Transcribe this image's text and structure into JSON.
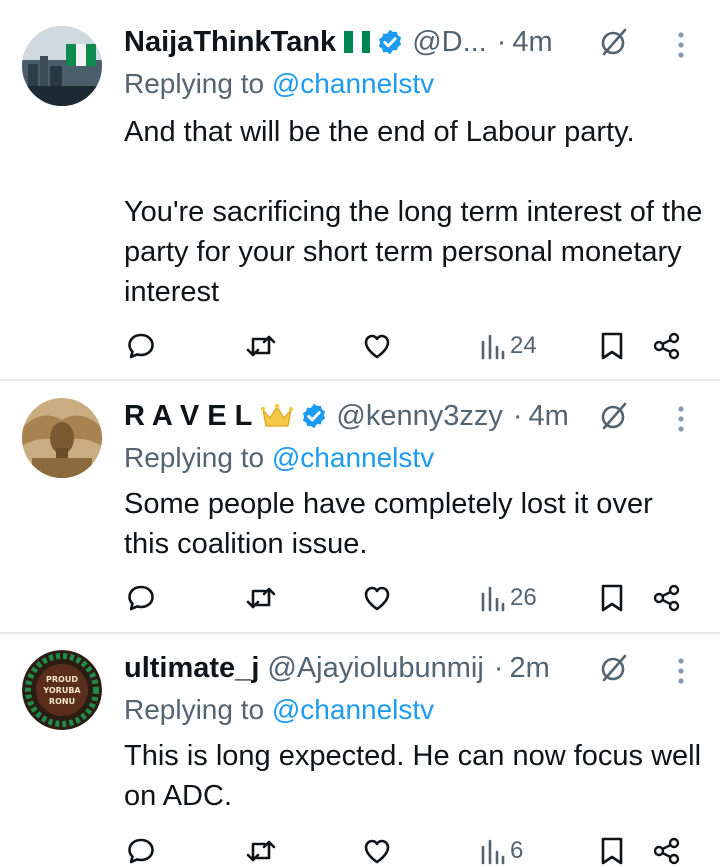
{
  "tweets": [
    {
      "name": "NaijaThinkTank",
      "has_flag": true,
      "verified": true,
      "handle": "@D...",
      "time": "4m",
      "replying_prefix": "Replying to ",
      "replying_to": "@channelstv",
      "text": "And that will be the end of Labour party.\n\nYou're sacrificing the long term interest of the party for your short term personal monetary interest",
      "views": "24",
      "avatar_icon": "profile-photo"
    },
    {
      "name": "R A V E L",
      "has_crown": true,
      "verified": true,
      "handle": "@kenny3zzy",
      "time": "4m",
      "replying_prefix": "Replying to ",
      "replying_to": "@channelstv",
      "text": "Some people have completely lost it over this coalition issue.",
      "views": "26",
      "avatar_icon": "profile-photo"
    },
    {
      "name": "ultimate_j",
      "verified": false,
      "handle": "@Ajayiolubunmij",
      "time": "2m",
      "replying_prefix": "Replying to ",
      "replying_to": "@channelstv",
      "text": "This is long expected. He can now focus well on ADC.",
      "views": "6",
      "avatar_icon": "profile-photo",
      "avatar_badge": [
        "PROUD",
        "YORUBA",
        "RONU"
      ]
    }
  ],
  "colors": {
    "text": "#0f1419",
    "secondary": "#536471",
    "link": "#1d9bf0",
    "verified": "#1d9bf0",
    "flag_green": "#008751",
    "divider": "#e6e9ec"
  }
}
